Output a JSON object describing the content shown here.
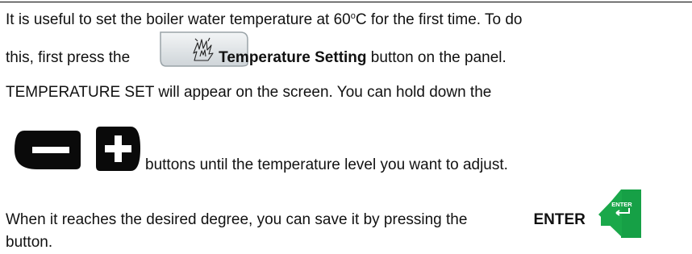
{
  "paragraph": {
    "line1": {
      "text": "It is useful to set the boiler water temperature at 60",
      "degree": "o",
      "tail": "C for the first time. To do"
    },
    "line2": {
      "before": "this, first press the",
      "bold": "Temperature Setting",
      "after": " button on the panel."
    },
    "line3": "TEMPERATURE SET will appear on the screen. You can hold down the",
    "line4": "buttons until the temperature level you want to adjust.",
    "line5": {
      "before": "When it reaches the desired degree, you can save it by pressing the",
      "bold": "ENTER"
    },
    "line6": "button."
  },
  "icons": {
    "temperature_setting": "flame-spark-icon",
    "minus": "minus-icon",
    "plus": "plus-icon",
    "enter": "enter-arrow-icon",
    "enter_label": "ENTER"
  },
  "colors": {
    "text": "#111111",
    "rule": "#000000",
    "button_border": "#9aa3a8",
    "button_face": "#dfe3e6",
    "minus_plus": "#0a0a0a",
    "enter_green": "#1aa84a"
  }
}
